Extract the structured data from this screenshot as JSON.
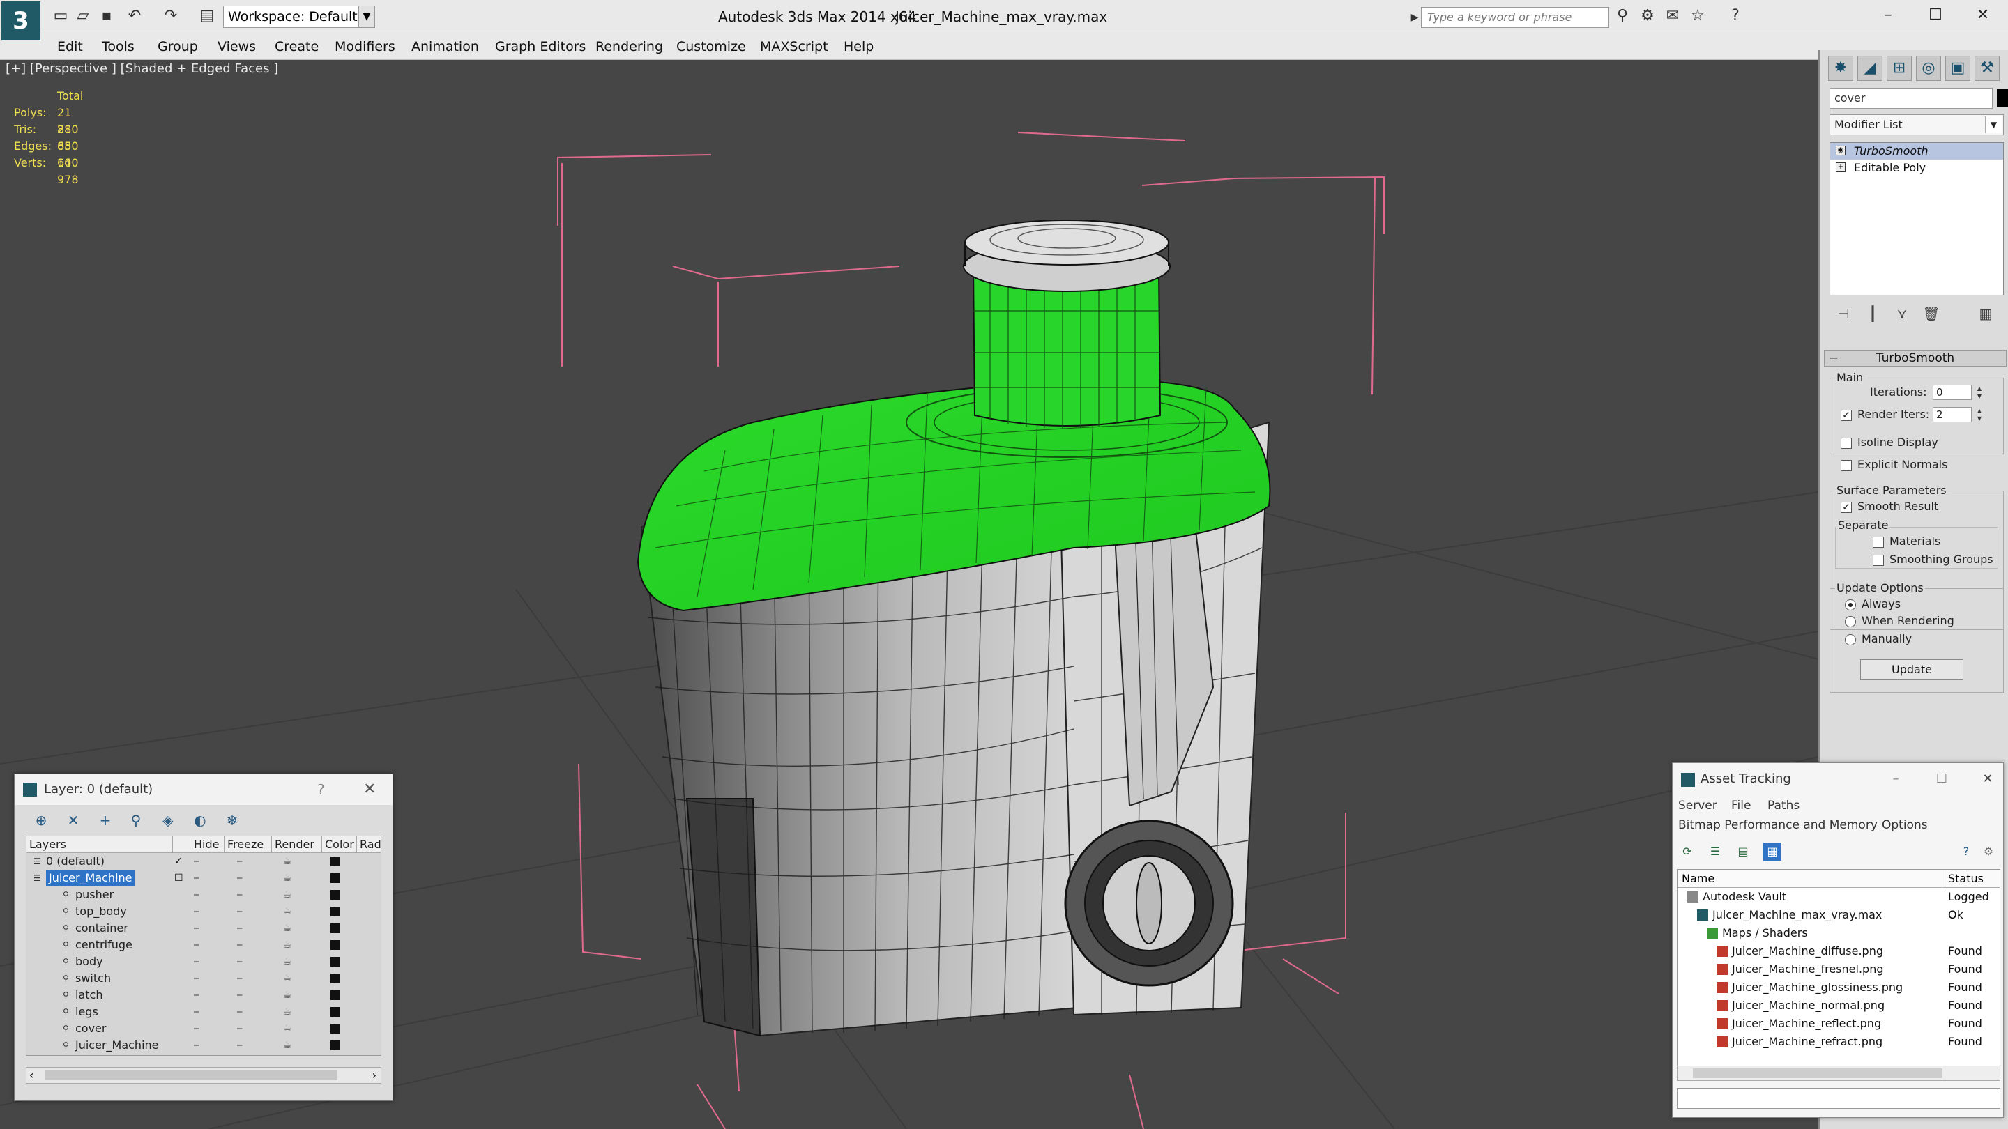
{
  "app": {
    "title": "Autodesk 3ds Max  2014 x64",
    "file": "Juicer_Machine_max_vray.max"
  },
  "quick_access": {
    "workspace_label": "Workspace: Default",
    "search_placeholder": "Type a keyword or phrase"
  },
  "menu": [
    "Edit",
    "Tools",
    "Group",
    "Views",
    "Create",
    "Modifiers",
    "Animation",
    "Graph Editors",
    "Rendering",
    "Customize",
    "MAXScript",
    "Help"
  ],
  "viewport": {
    "label": "[+] [Perspective ] [Shaded + Edged Faces ]",
    "stats": {
      "header": "Total",
      "rows": [
        {
          "label": "Polys:",
          "value": "21 880"
        },
        {
          "label": "Tris:",
          "value": "21 880"
        },
        {
          "label": "Edges:",
          "value": "65 640"
        },
        {
          "label": "Verts:",
          "value": "10 978"
        }
      ]
    },
    "colors": {
      "background": "#464646",
      "grid": "#3a3a3a",
      "selection_bracket": "#e06a8e",
      "green_shell": "#27dc2b",
      "body": "#8a8a8a"
    }
  },
  "command_panel": {
    "object_name": "cover",
    "object_color": "#000000",
    "modifier_list": "Modifier List",
    "stack": [
      "TurboSmooth",
      "Editable Poly"
    ],
    "turbosmooth": {
      "title": "TurboSmooth",
      "main_label": "Main",
      "iterations_label": "Iterations:",
      "iterations_value": "0",
      "render_iters_label": "Render Iters:",
      "render_iters_value": "2",
      "isoline": "Isoline Display",
      "explicit": "Explicit Normals",
      "surface_label": "Surface Parameters",
      "smooth_result": "Smooth Result",
      "separate_label": "Separate",
      "materials": "Materials",
      "smoothing_groups": "Smoothing Groups",
      "update_label": "Update Options",
      "always": "Always",
      "when_rendering": "When Rendering",
      "manually": "Manually",
      "update_button": "Update"
    }
  },
  "layer_window": {
    "title": "Layer: 0 (default)",
    "help": "?",
    "columns": [
      "Layers",
      "Hide",
      "Freeze",
      "Render",
      "Color",
      "Rad"
    ],
    "rows": [
      {
        "name": "0 (default)",
        "level": 0,
        "checked": true
      },
      {
        "name": "Juicer_Machine",
        "level": 0,
        "selected": true
      },
      {
        "name": "pusher",
        "level": 1
      },
      {
        "name": "top_body",
        "level": 1
      },
      {
        "name": "container",
        "level": 1
      },
      {
        "name": "centrifuge",
        "level": 1
      },
      {
        "name": "body",
        "level": 1
      },
      {
        "name": "switch",
        "level": 1
      },
      {
        "name": "latch",
        "level": 1
      },
      {
        "name": "legs",
        "level": 1
      },
      {
        "name": "cover",
        "level": 1
      },
      {
        "name": "Juicer_Machine",
        "level": 1
      }
    ]
  },
  "asset_tracking": {
    "title": "Asset Tracking",
    "menu1": [
      "Server",
      "File",
      "Paths"
    ],
    "menu2": [
      "Bitmap Performance and Memory",
      "Options"
    ],
    "columns": [
      "Name",
      "Status"
    ],
    "rows": [
      {
        "name": "Autodesk Vault",
        "status": "Logged O",
        "indent": 0,
        "icon": "vault-icon"
      },
      {
        "name": "Juicer_Machine_max_vray.max",
        "status": "Ok",
        "indent": 1,
        "icon": "max-file-icon"
      },
      {
        "name": "Maps / Shaders",
        "status": "",
        "indent": 2,
        "icon": "maps-icon"
      },
      {
        "name": "Juicer_Machine_diffuse.png",
        "status": "Found",
        "indent": 3,
        "icon": "png-icon"
      },
      {
        "name": "Juicer_Machine_fresnel.png",
        "status": "Found",
        "indent": 3,
        "icon": "png-icon"
      },
      {
        "name": "Juicer_Machine_glossiness.png",
        "status": "Found",
        "indent": 3,
        "icon": "png-icon"
      },
      {
        "name": "Juicer_Machine_normal.png",
        "status": "Found",
        "indent": 3,
        "icon": "png-icon"
      },
      {
        "name": "Juicer_Machine_reflect.png",
        "status": "Found",
        "indent": 3,
        "icon": "png-icon"
      },
      {
        "name": "Juicer_Machine_refract.png",
        "status": "Found",
        "indent": 3,
        "icon": "png-icon"
      }
    ]
  }
}
